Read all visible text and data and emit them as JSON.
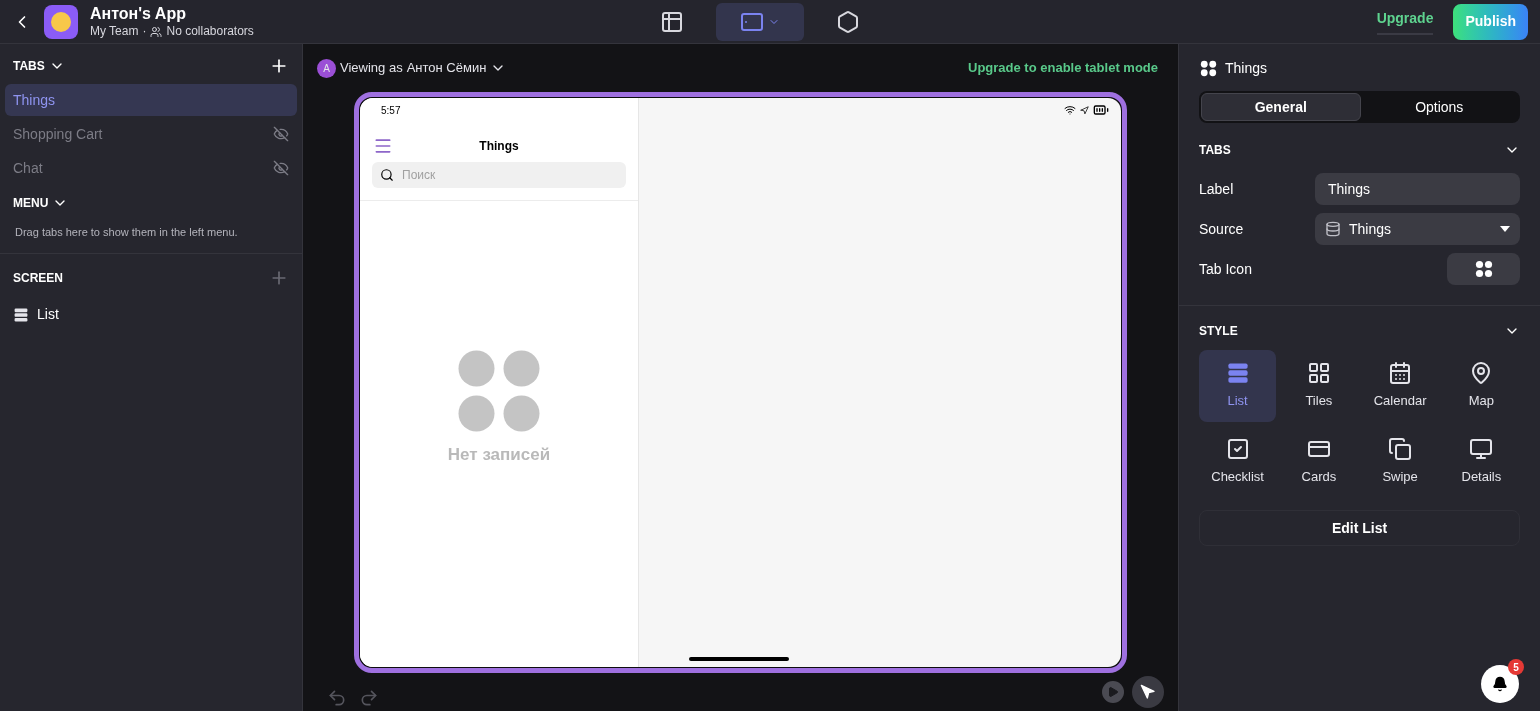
{
  "app": {
    "title": "Антон's App",
    "team": "My Team",
    "separator": "·",
    "collaborators": "No collaborators"
  },
  "toolbar": [
    {
      "kind": "data",
      "selected": false
    },
    {
      "kind": "tablet",
      "selected": true
    },
    {
      "kind": "settings",
      "selected": false
    }
  ],
  "upgrade": "Upgrade",
  "publish": "Publish",
  "sidebar": {
    "tabs_title": "TABS",
    "tabs": [
      {
        "label": "Things",
        "selected": true,
        "hidden": false
      },
      {
        "label": "Shopping Cart",
        "selected": false,
        "hidden": true
      },
      {
        "label": "Chat",
        "selected": false,
        "hidden": true
      }
    ],
    "menu_title": "MENU",
    "menu_hint": "Drag tabs here to show them in the left menu.",
    "screen_title": "SCREEN",
    "screen_items": [
      {
        "label": "List",
        "selected": false
      }
    ]
  },
  "canvas": {
    "avatar": "A",
    "viewing_prefix": "Viewing as",
    "viewing_name": "Антон Сёмин",
    "upgrade_notice": "Upgrade to enable tablet mode",
    "device": {
      "time": "5:57",
      "title": "Things",
      "search_placeholder": "Поиск",
      "empty_text": "Нет записей"
    }
  },
  "panel": {
    "title": "Things",
    "segments": [
      {
        "label": "General",
        "selected": true
      },
      {
        "label": "Options",
        "selected": false
      }
    ],
    "tabs_title": "TABS",
    "label_label": "Label",
    "label_value": "Things",
    "source_label": "Source",
    "source_value": "Things",
    "tab_icon_label": "Tab Icon",
    "style_title": "STYLE",
    "styles": [
      {
        "kind": "list",
        "label": "List",
        "selected": true
      },
      {
        "kind": "tiles",
        "label": "Tiles",
        "selected": false
      },
      {
        "kind": "calendar",
        "label": "Calendar",
        "selected": false
      },
      {
        "kind": "map",
        "label": "Map",
        "selected": false
      },
      {
        "kind": "checklist",
        "label": "Checklist",
        "selected": false
      },
      {
        "kind": "cards",
        "label": "Cards",
        "selected": false
      },
      {
        "kind": "swipe",
        "label": "Swipe",
        "selected": false
      },
      {
        "kind": "details",
        "label": "Details",
        "selected": false
      }
    ],
    "edit_button": "Edit List"
  },
  "notifications": {
    "count": "5"
  }
}
